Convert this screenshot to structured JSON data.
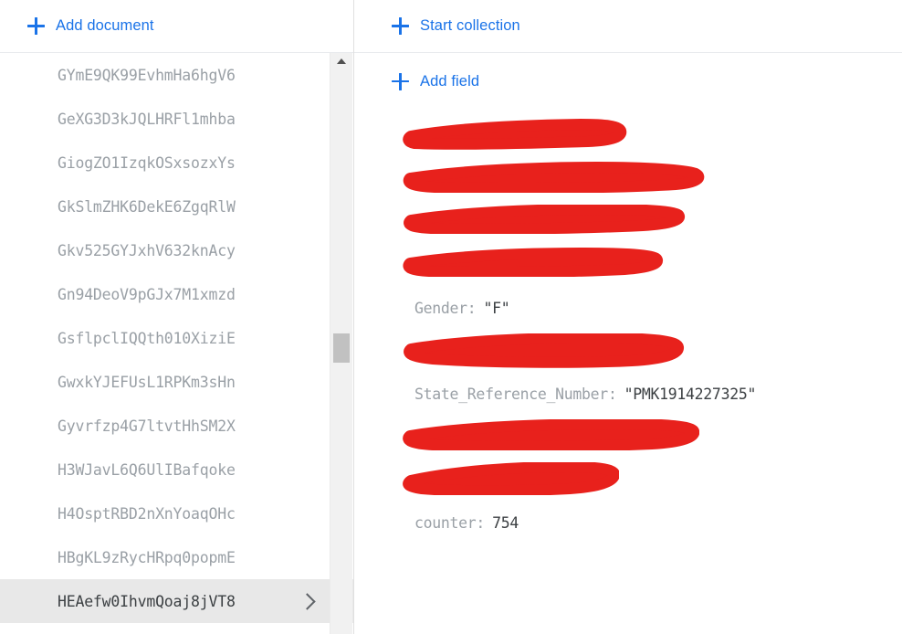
{
  "colors": {
    "accent_blue": "#1a73e8",
    "redaction_red": "#e8211c",
    "selected_row_bg": "#e8e8e8",
    "key_gray": "#9aa0a6",
    "value_dark": "#3c4043"
  },
  "documents_panel": {
    "add_document_label": "Add document",
    "add_document_icon": "plus-icon",
    "scrollbar": {
      "up_arrow_icon": "triangle-up-icon"
    },
    "documents": [
      {
        "id": "GYmE9QK99EvhmHa6hgV6",
        "selected": false
      },
      {
        "id": "GeXG3D3kJQLHRFl1mhba",
        "selected": false
      },
      {
        "id": "GiogZO1IzqkOSxsozxYs",
        "selected": false
      },
      {
        "id": "GkSlmZHK6DekE6ZgqRlW",
        "selected": false
      },
      {
        "id": "Gkv525GYJxhV632knAcy",
        "selected": false
      },
      {
        "id": "Gn94DeoV9pGJx7M1xmzd",
        "selected": false
      },
      {
        "id": "GsflpclIQQth010XiziE",
        "selected": false
      },
      {
        "id": "GwxkYJEFUsL1RPKm3sHn",
        "selected": false
      },
      {
        "id": "Gyvrfzp4G7ltvtHhSM2X",
        "selected": false
      },
      {
        "id": "H3WJavL6Q6UlIBafqoke",
        "selected": false
      },
      {
        "id": "H4OsptRBD2nXnYoaqOHc",
        "selected": false
      },
      {
        "id": "HBgKL9zRycHRpq0popmE",
        "selected": false
      },
      {
        "id": "HEAefw0IhvmQoaj8jVT8",
        "selected": true
      }
    ],
    "selected_row_chevron_icon": "chevron-right-icon"
  },
  "detail_panel": {
    "start_collection_label": "Start collection",
    "start_collection_icon": "plus-icon",
    "add_field_label": "Add field",
    "add_field_icon": "plus-icon",
    "fields": [
      {
        "key": "",
        "value": "",
        "redacted": true,
        "stroke": 0
      },
      {
        "key": "",
        "value": "",
        "redacted": true,
        "stroke": 1
      },
      {
        "key": "",
        "value": "",
        "redacted": true,
        "stroke": 2
      },
      {
        "key": "",
        "value": "",
        "redacted": true,
        "stroke": 3
      },
      {
        "key": "Gender:",
        "value": "\"F\"",
        "redacted": false
      },
      {
        "key": "",
        "value": "",
        "redacted": true,
        "stroke": 4
      },
      {
        "key": "State_Reference_Number:",
        "value": "\"PMK1914227325\"",
        "redacted": false
      },
      {
        "key": "",
        "value": "",
        "redacted": true,
        "stroke": 5
      },
      {
        "key": "",
        "value": "",
        "redacted": true,
        "stroke": 6
      },
      {
        "key": "counter:",
        "value": "754",
        "redacted": false
      }
    ]
  }
}
